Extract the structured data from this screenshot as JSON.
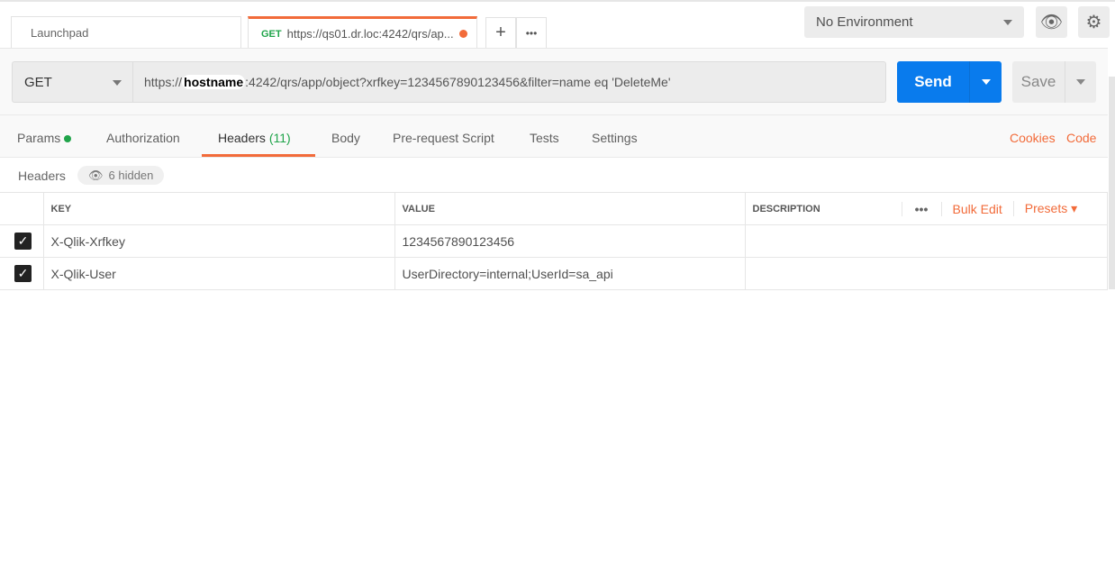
{
  "tabs": [
    {
      "label": "Launchpad"
    },
    {
      "method": "GET",
      "label": "https://qs01.dr.loc:4242/qrs/ap..."
    }
  ],
  "tab_actions": {
    "new": "+",
    "more": "•••"
  },
  "environment": {
    "selected": "No Environment"
  },
  "request": {
    "method": "GET",
    "url_prefix": "https://",
    "url_host": "hostname",
    "url_rest": ":4242/qrs/app/object?xrfkey=1234567890123456&filter=name eq 'DeleteMe'",
    "send": "Send",
    "save": "Save"
  },
  "req_tabs": [
    {
      "label": "Params"
    },
    {
      "label": "Authorization"
    },
    {
      "label": "Headers",
      "count": "(11)"
    },
    {
      "label": "Body"
    },
    {
      "label": "Pre-request Script"
    },
    {
      "label": "Tests"
    },
    {
      "label": "Settings"
    }
  ],
  "links": {
    "cookies": "Cookies",
    "code": "Code"
  },
  "headers_section": {
    "title": "Headers",
    "hidden": "6 hidden"
  },
  "table": {
    "columns": [
      "KEY",
      "VALUE",
      "DESCRIPTION"
    ],
    "bulk_edit": "Bulk Edit",
    "presets": "Presets",
    "more": "•••",
    "rows": [
      {
        "key": "X-Qlik-Xrfkey",
        "value": "1234567890123456",
        "description": ""
      },
      {
        "key": "X-Qlik-User",
        "value": "UserDirectory=internal;UserId=sa_api",
        "description": ""
      }
    ]
  },
  "colors": {
    "accent": "#f26b3a",
    "send": "#097bed",
    "params_dot": "#20a44a"
  }
}
